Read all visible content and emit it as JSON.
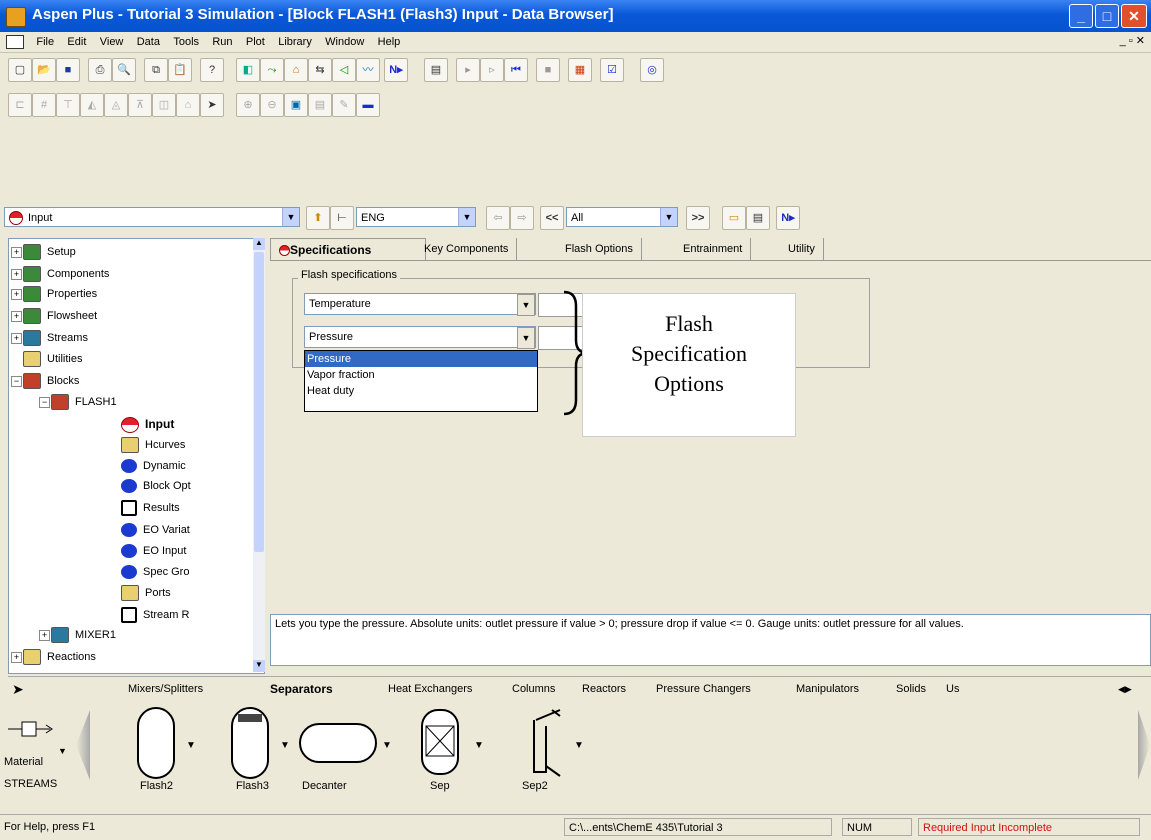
{
  "window": {
    "title": "Aspen Plus - Tutorial 3 Simulation - [Block FLASH1 (Flash3) Input - Data Browser]"
  },
  "menu": [
    "File",
    "Edit",
    "View",
    "Data",
    "Tools",
    "Run",
    "Plot",
    "Library",
    "Window",
    "Help"
  ],
  "nav": {
    "location": "Input",
    "units": "ENG",
    "filter": "All",
    "prev": "<<",
    "next": ">>"
  },
  "tree": {
    "items": [
      {
        "label": "Setup"
      },
      {
        "label": "Components"
      },
      {
        "label": "Properties"
      },
      {
        "label": "Flowsheet"
      },
      {
        "label": "Streams"
      },
      {
        "label": "Utilities"
      },
      {
        "label": "Blocks"
      },
      {
        "label": "FLASH1"
      },
      {
        "label": "Input"
      },
      {
        "label": "Hcurves"
      },
      {
        "label": "Dynamic"
      },
      {
        "label": "Block Opt"
      },
      {
        "label": "Results"
      },
      {
        "label": "EO Variat"
      },
      {
        "label": "EO Input"
      },
      {
        "label": "Spec Gro"
      },
      {
        "label": "Ports"
      },
      {
        "label": "Stream R"
      },
      {
        "label": "MIXER1"
      },
      {
        "label": "Reactions"
      }
    ]
  },
  "tabs": [
    "Specifications",
    "Key Components",
    "Flash Options",
    "Entrainment",
    "Utility"
  ],
  "flash": {
    "group_label": "Flash specifications",
    "spec1": "Temperature",
    "spec2": "Pressure",
    "options": [
      "Pressure",
      "Vapor fraction",
      "Heat duty"
    ]
  },
  "callout": {
    "line1": "Flash",
    "line2": "Specification",
    "line3": "Options"
  },
  "hint": "Lets you type the pressure. Absolute units: outlet pressure if value > 0; pressure drop if value <= 0. Gauge units: outlet pressure for all values.",
  "library": {
    "tabs": [
      "Mixers/Splitters",
      "Separators",
      "Heat Exchangers",
      "Columns",
      "Reactors",
      "Pressure Changers",
      "Manipulators",
      "Solids",
      "Us"
    ],
    "models": [
      "Flash2",
      "Flash3",
      "Decanter",
      "Sep",
      "Sep2"
    ],
    "streams_label": "Material",
    "streams_caption": "STREAMS"
  },
  "status": {
    "help": "For Help, press F1",
    "path": "C:\\...ents\\ChemE 435\\Tutorial 3",
    "num": "NUM",
    "state": "Required Input Incomplete"
  }
}
